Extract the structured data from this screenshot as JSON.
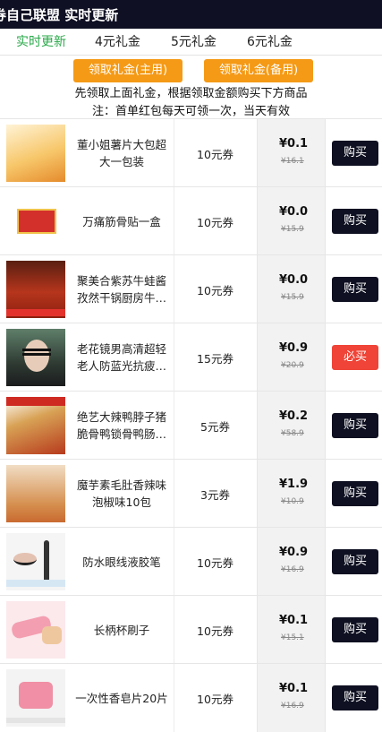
{
  "header": {
    "title": "券自己联盟 实时更新"
  },
  "tabs": [
    {
      "label": "实时更新",
      "active": true
    },
    {
      "label": "4元礼金",
      "active": false
    },
    {
      "label": "5元礼金",
      "active": false
    },
    {
      "label": "6元礼金",
      "active": false
    }
  ],
  "buttons": {
    "main_label": "领取礼金(主用)",
    "backup_label": "领取礼金(备用)"
  },
  "notes": {
    "line1": "先领取上面礼金，根据领取金额购买下方商品",
    "line2": "注：首单红包每天可领一次，当天有效"
  },
  "products": [
    {
      "name": "董小姐薯片大包超大一包装",
      "coupon": "10元券",
      "price": "¥0.1",
      "original": "¥16.1",
      "buy": "购买",
      "buy_style": "normal",
      "image": "potato-chips-image"
    },
    {
      "name": "万痛筋骨贴一盒",
      "coupon": "10元券",
      "price": "¥0.0",
      "original": "¥15.9",
      "buy": "购买",
      "buy_style": "normal",
      "image": "bone-patch-image"
    },
    {
      "name": "聚美合紫苏牛蛙酱孜然干锅厨房牛蛙来哒…",
      "coupon": "10元券",
      "price": "¥0.0",
      "original": "¥15.9",
      "buy": "购买",
      "buy_style": "normal",
      "image": "bullfrog-sauce-image"
    },
    {
      "name": "老花镜男高清超轻老人防蓝光抗疲劳老…",
      "coupon": "15元券",
      "price": "¥0.9",
      "original": "¥20.9",
      "buy": "必买",
      "buy_style": "must",
      "image": "reading-glasses-image"
    },
    {
      "name": "绝艺大辣鸭脖子猪脆骨鸭锁骨鸭肠鸭翅…",
      "coupon": "5元券",
      "price": "¥0.2",
      "original": "¥58.9",
      "buy": "购买",
      "buy_style": "normal",
      "image": "spicy-duck-image"
    },
    {
      "name": "魔芋素毛肚香辣味泡椒味10包",
      "coupon": "3元券",
      "price": "¥1.9",
      "original": "¥10.9",
      "buy": "购买",
      "buy_style": "normal",
      "image": "konjac-snack-image"
    },
    {
      "name": "防水眼线液胶笔",
      "coupon": "10元券",
      "price": "¥0.9",
      "original": "¥16.9",
      "buy": "购买",
      "buy_style": "normal",
      "image": "eyeliner-image"
    },
    {
      "name": "长柄杯刷子",
      "coupon": "10元券",
      "price": "¥0.1",
      "original": "¥15.1",
      "buy": "购买",
      "buy_style": "normal",
      "image": "cup-brush-image"
    },
    {
      "name": "一次性香皂片20片",
      "coupon": "10元券",
      "price": "¥0.1",
      "original": "¥16.9",
      "buy": "购买",
      "buy_style": "normal",
      "image": "soap-sheets-image"
    }
  ],
  "colors": {
    "header_bg": "#0f1023",
    "tab_active": "#2aa84a",
    "coupon_button": "#f59a16",
    "buy_button": "#0f1122",
    "must_buy_button": "#ef4437"
  }
}
